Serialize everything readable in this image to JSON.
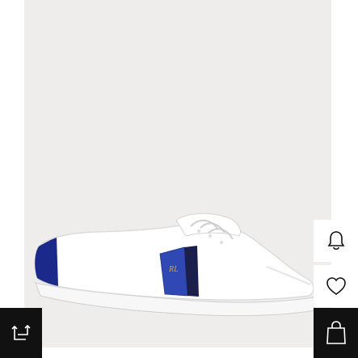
{
  "product": {
    "image_icon": "ralph-lauren-white-sneaker-image",
    "stripe_colors": [
      "#1f3fa6",
      "#1b1f4b"
    ],
    "monogram": "RL"
  },
  "actions": {
    "notify_icon": "bell-icon",
    "wishlist_icon": "heart-icon",
    "bag_icon": "shopping-bag-icon",
    "compare_icon": "share-arrows-icon"
  },
  "colors": {
    "panel_bg": "#efedeb",
    "dark_button": "#111111",
    "light_button": "#ffffff"
  }
}
